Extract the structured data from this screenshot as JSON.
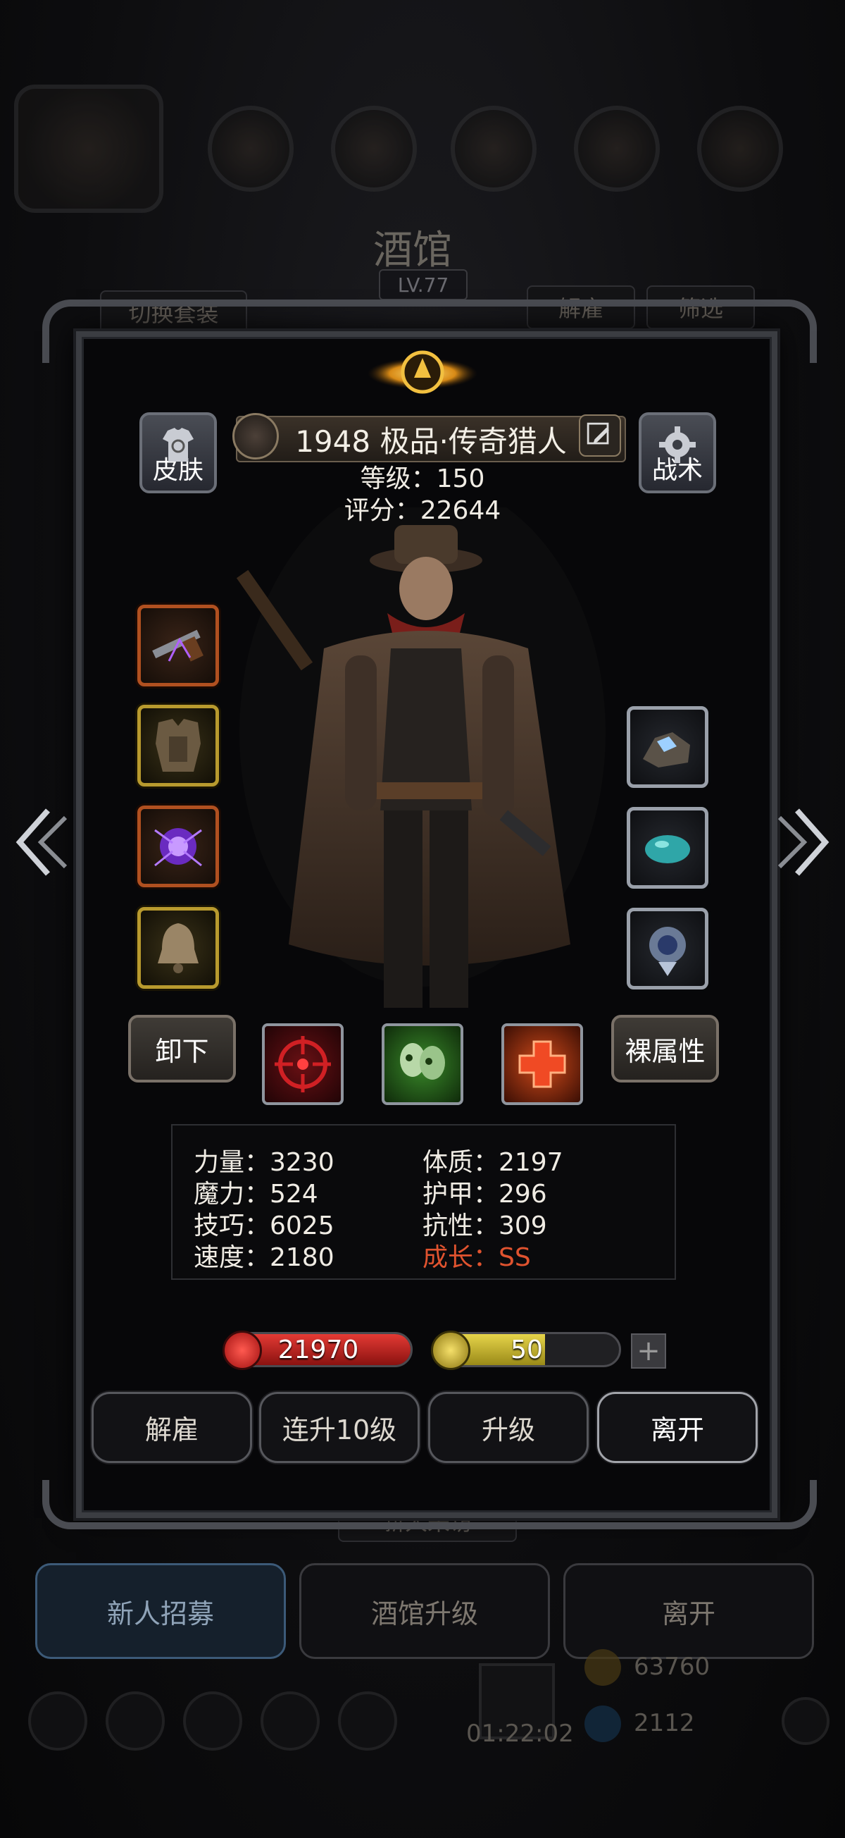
{
  "background": {
    "title": "酒馆",
    "level": "LV.77",
    "switch_outfit": "切换套装",
    "dismiss": "解雇",
    "filter": "筛选",
    "visitor": "新人来访",
    "bottom_buttons": [
      "新人招募",
      "酒馆升级",
      "离开"
    ],
    "gold": "63760",
    "gems": "2112",
    "timer": "01:22:02"
  },
  "hero": {
    "name": "1948 极品·传奇猎人",
    "level_label": "等级：150",
    "score_label": "评分：22644",
    "skin_label": "皮肤",
    "tactics_label": "战术"
  },
  "equipment": {
    "left": [
      "weapon-rifle-icon",
      "armor-icon",
      "purple-orb-icon",
      "bell-icon"
    ],
    "right": [
      "crystal-ore-icon",
      "teal-stone-icon",
      "amulet-icon"
    ]
  },
  "skills_row": {
    "unequip": "卸下",
    "bare_stats": "裸属性",
    "skills": [
      "crosshair-skill-icon",
      "skull-skill-icon",
      "heal-cross-skill-icon"
    ]
  },
  "attributes": {
    "left": [
      "力量：3230",
      "魔力：524",
      "技巧：6025",
      "速度：2180"
    ],
    "right": [
      "体质：2197",
      "护甲：296",
      "抗性：309"
    ],
    "growth": "成长：SS"
  },
  "bars": {
    "hp": "21970",
    "hp_fill": 1.0,
    "energy": "50",
    "energy_fill": 0.6
  },
  "actions": [
    "解雇",
    "连升10级",
    "升级",
    "离开"
  ],
  "colors": {
    "accent_red": "#e0532f",
    "hp_red": "#c0201f",
    "energy_yellow": "#c9b530"
  }
}
